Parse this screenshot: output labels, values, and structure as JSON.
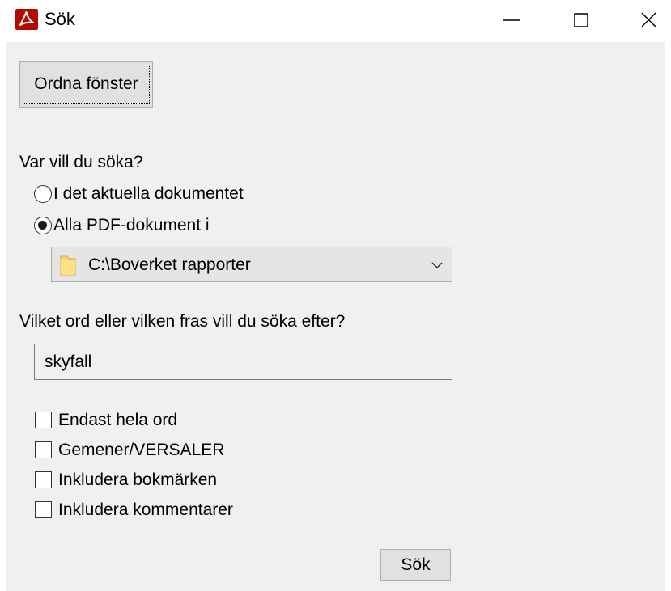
{
  "window": {
    "title": "Sök"
  },
  "toolbar": {
    "arrange_label": "Ordna fönster"
  },
  "scope": {
    "question": "Var vill du söka?",
    "options": [
      {
        "label": "I det aktuella dokumentet",
        "selected": false
      },
      {
        "label": "Alla PDF-dokument i",
        "selected": true
      }
    ],
    "folder": {
      "value": "C:\\Boverket rapporter",
      "icon": "folder-icon"
    }
  },
  "query": {
    "question": "Vilket ord eller vilken fras vill du söka efter?",
    "value": "skyfall"
  },
  "options": [
    {
      "label": "Endast hela ord",
      "checked": false
    },
    {
      "label": "Gemener/VERSALER",
      "checked": false
    },
    {
      "label": "Inkludera bokmärken",
      "checked": false
    },
    {
      "label": "Inkludera kommentarer",
      "checked": false
    }
  ],
  "actions": {
    "search_label": "Sök"
  },
  "colors": {
    "dialog_background": "#f0f0f0",
    "button_face": "#e1e1e1",
    "acrobat_red": "#b30b00",
    "folder_yellow": "#ffd66e"
  }
}
